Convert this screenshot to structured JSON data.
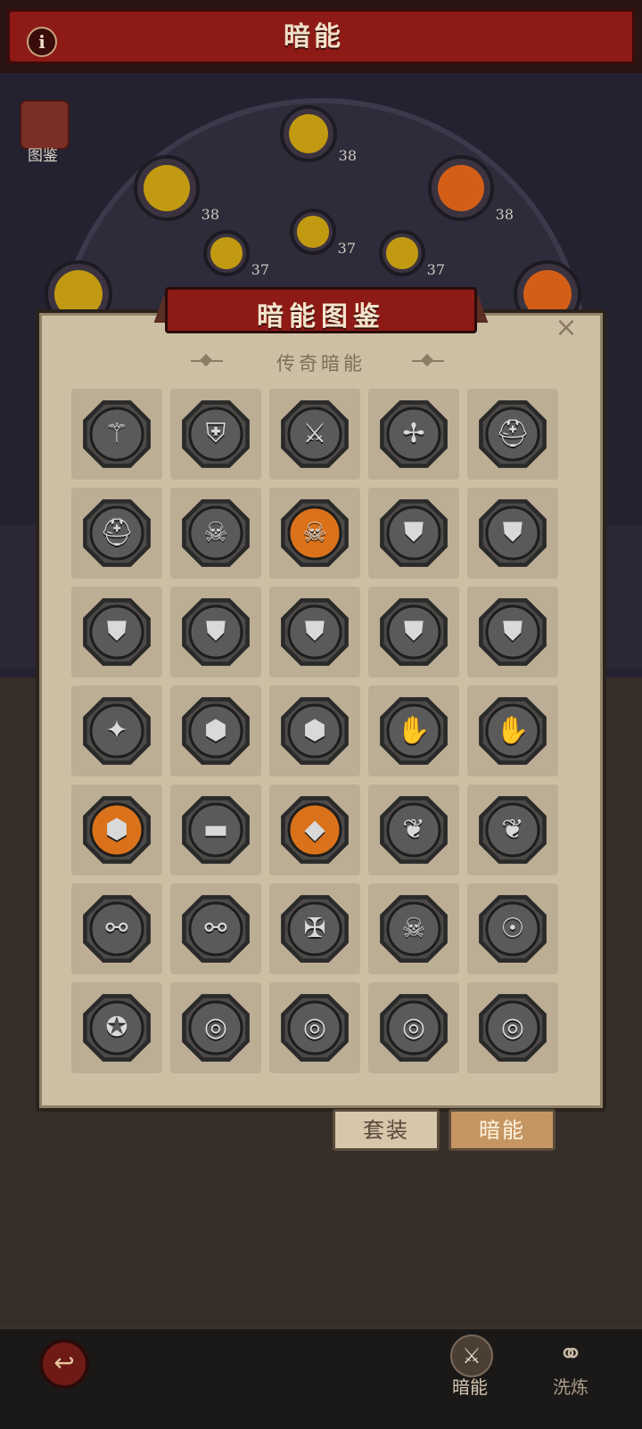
{
  "header": {
    "title": "暗能",
    "info_icon": "i"
  },
  "codex_button": {
    "label": "图鉴"
  },
  "altar_nodes": [
    {
      "level": "38",
      "color": "gold"
    },
    {
      "level": "38",
      "color": "gold"
    },
    {
      "level": "38",
      "color": "orange"
    },
    {
      "level": "37",
      "color": "gold"
    },
    {
      "level": "37",
      "color": "gold"
    },
    {
      "level": "37",
      "color": "gold"
    }
  ],
  "dialog": {
    "title": "暗能图鉴",
    "close_label": "×",
    "section_title": "传奇暗能",
    "items": [
      {
        "icon": "staff-icon",
        "glyph": "⚚",
        "unlocked": false
      },
      {
        "icon": "shield-sword-icon",
        "glyph": "⛨",
        "unlocked": false
      },
      {
        "icon": "axe-icon",
        "glyph": "⚔",
        "unlocked": false
      },
      {
        "icon": "winged-sword-icon",
        "glyph": "✢",
        "unlocked": false
      },
      {
        "icon": "helmet-icon",
        "glyph": "⛑",
        "unlocked": false
      },
      {
        "icon": "horned-helmet-icon",
        "glyph": "⛑",
        "unlocked": false
      },
      {
        "icon": "crown-skull-icon",
        "glyph": "☠",
        "unlocked": false
      },
      {
        "icon": "demon-mask-icon",
        "glyph": "☠",
        "unlocked": true
      },
      {
        "icon": "chestplate-icon",
        "glyph": "⛊",
        "unlocked": false
      },
      {
        "icon": "armor-icon",
        "glyph": "⛊",
        "unlocked": false
      },
      {
        "icon": "spiked-armor-icon",
        "glyph": "⛊",
        "unlocked": false
      },
      {
        "icon": "breastplate-icon",
        "glyph": "⛊",
        "unlocked": false
      },
      {
        "icon": "leg-armor-icon",
        "glyph": "⛊",
        "unlocked": false
      },
      {
        "icon": "greaves-icon",
        "glyph": "⛊",
        "unlocked": false
      },
      {
        "icon": "plate-armor-icon",
        "glyph": "⛊",
        "unlocked": false
      },
      {
        "icon": "spiked-boots-icon",
        "glyph": "✦",
        "unlocked": false
      },
      {
        "icon": "boots-icon",
        "glyph": "⬢",
        "unlocked": false
      },
      {
        "icon": "war-boots-icon",
        "glyph": "⬢",
        "unlocked": false
      },
      {
        "icon": "gauntlet-icon",
        "glyph": "✋",
        "unlocked": false
      },
      {
        "icon": "horned-gauntlet-icon",
        "glyph": "✋",
        "unlocked": false
      },
      {
        "icon": "blue-boots-icon",
        "glyph": "⬢",
        "unlocked": true
      },
      {
        "icon": "belt-icon",
        "glyph": "▬",
        "unlocked": false
      },
      {
        "icon": "blue-belt-icon",
        "glyph": "◆",
        "unlocked": true
      },
      {
        "icon": "pendant-icon",
        "glyph": "❦",
        "unlocked": false
      },
      {
        "icon": "chain-necklace-icon",
        "glyph": "❦",
        "unlocked": false
      },
      {
        "icon": "spiked-necklace-icon",
        "glyph": "⚯",
        "unlocked": false
      },
      {
        "icon": "chain-pendant-icon",
        "glyph": "⚯",
        "unlocked": false
      },
      {
        "icon": "winged-amulet-icon",
        "glyph": "✠",
        "unlocked": false
      },
      {
        "icon": "bat-skull-icon",
        "glyph": "☠",
        "unlocked": false
      },
      {
        "icon": "mask-amulet-icon",
        "glyph": "☉",
        "unlocked": false
      },
      {
        "icon": "spiked-ring-icon",
        "glyph": "✪",
        "unlocked": false
      },
      {
        "icon": "band-ring-icon",
        "glyph": "◎",
        "unlocked": false
      },
      {
        "icon": "dragon-ring-icon",
        "glyph": "◎",
        "unlocked": false
      },
      {
        "icon": "twisted-ring-icon",
        "glyph": "◎",
        "unlocked": false
      },
      {
        "icon": "gem-ring-icon",
        "glyph": "◎",
        "unlocked": false
      }
    ]
  },
  "tabs": {
    "suit": "套装",
    "dark_energy": "暗能"
  },
  "nav": {
    "back_icon": "↩",
    "dark_energy_label": "暗能",
    "refine_label": "洗炼"
  },
  "colors": {
    "locked_badge": "#5a5a5a",
    "unlocked_badge": "#d9721a",
    "banner_red": "#8e1a16"
  }
}
